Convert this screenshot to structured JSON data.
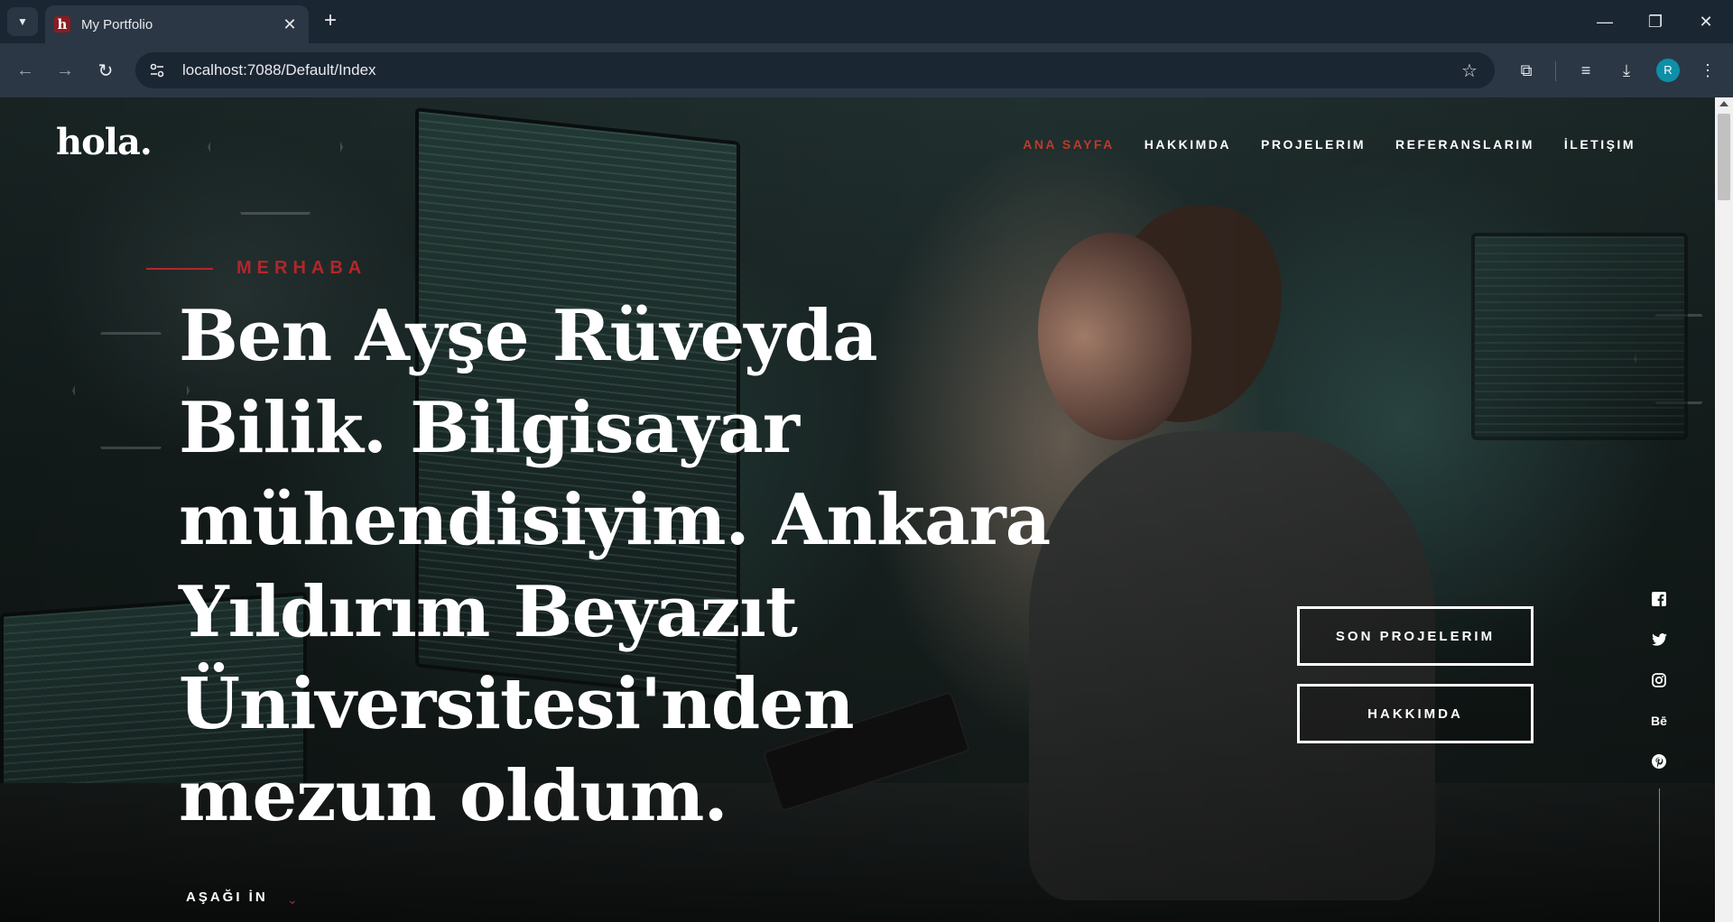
{
  "browser": {
    "tab_title": "My Portfolio",
    "favicon_letter": "h",
    "url": "localhost:7088/Default/Index",
    "profile_initial": "R"
  },
  "site": {
    "logo": "hola.",
    "nav": [
      {
        "label": "ANA SAYFA",
        "active": true
      },
      {
        "label": "HAKKIMDA",
        "active": false
      },
      {
        "label": "PROJELERIM",
        "active": false
      },
      {
        "label": "REFERANSLARIM",
        "active": false
      },
      {
        "label": "İLETIŞIM",
        "active": false
      }
    ],
    "accent_color": "#b3262a"
  },
  "hero": {
    "pre_title": "MERHABA",
    "title": "Ben Ayşe Rüveyda Bilik. Bilgisayar mühendisiyim. Ankara Yıldırım Beyazıt Üniversitesi'nden mezun oldum.",
    "buttons": {
      "projects": "SON PROJELERIM",
      "about": "HAKKIMDA"
    },
    "scroll_down": "AŞAĞI İN"
  },
  "social": {
    "behance_label": "Bē"
  }
}
